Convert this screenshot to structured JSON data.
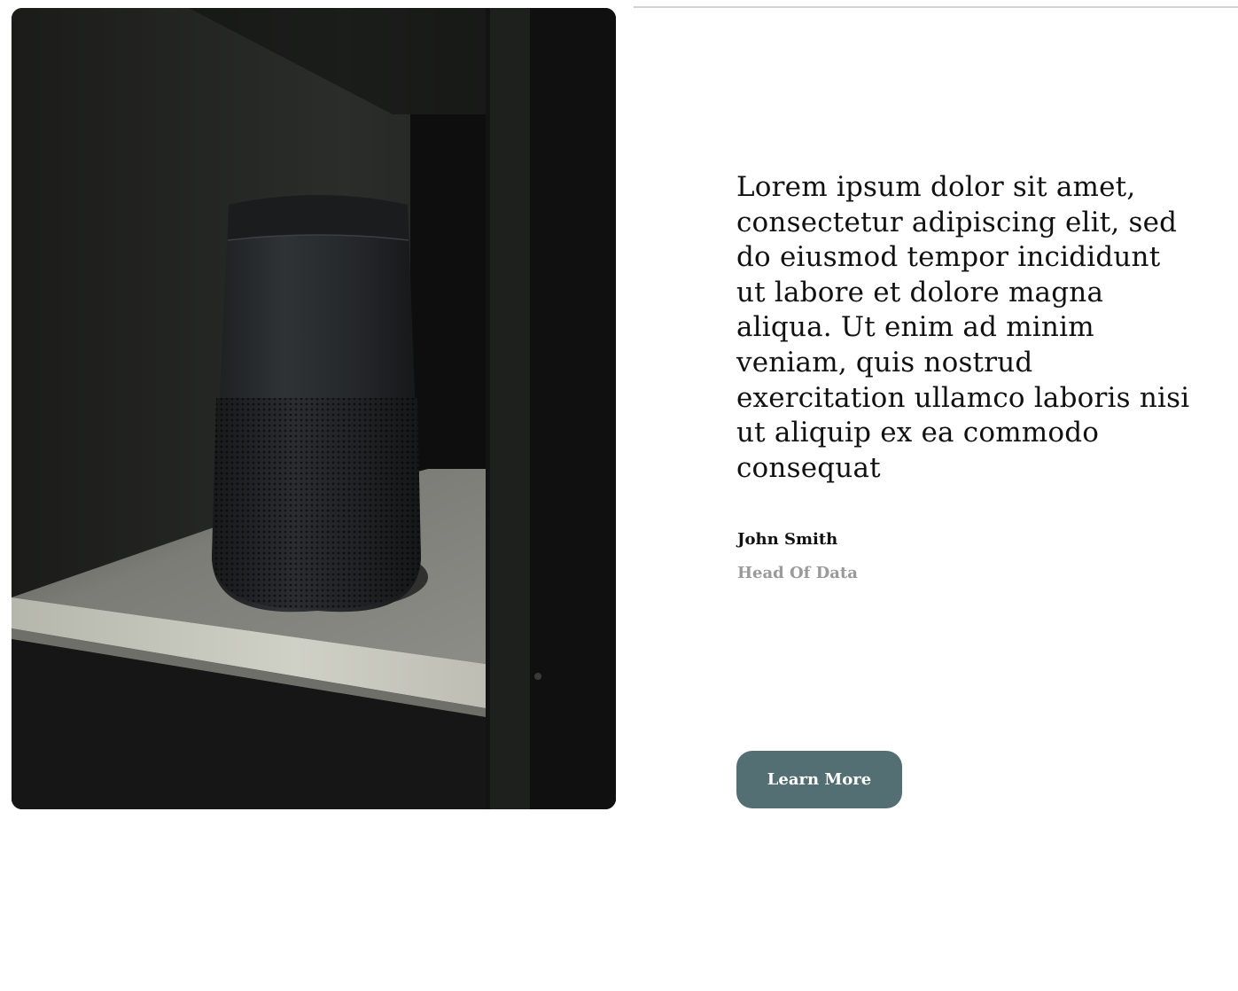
{
  "photo": {
    "alt": "Black cylindrical speaker on a shelf"
  },
  "testimonial": {
    "quote": "Lorem ipsum dolor sit amet, consectetur adipiscing elit, sed do eiusmod tempor incididunt ut labore et dolore magna aliqua. Ut enim ad minim veniam, quis nostrud exercitation ullamco laboris nisi ut aliquip ex ea commodo consequat",
    "author_name": "John Smith",
    "author_role": "Head Of Data"
  },
  "cta": {
    "label": "Learn More"
  },
  "colors": {
    "button": "#536f73",
    "role_text": "#9a9a9a",
    "text": "#111111"
  }
}
